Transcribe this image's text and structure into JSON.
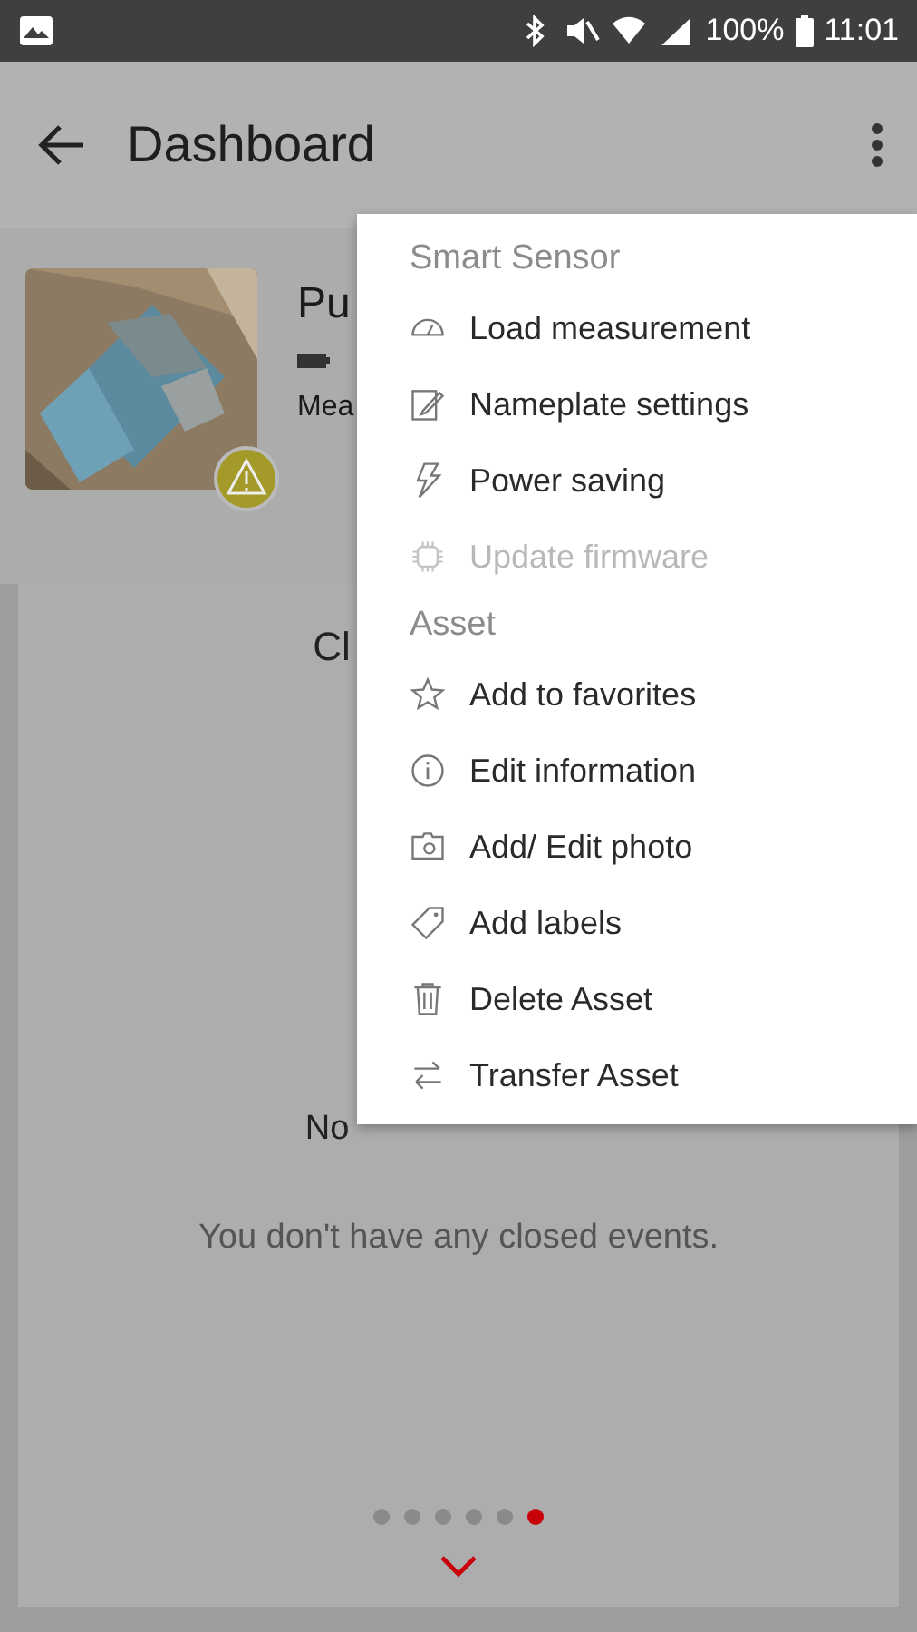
{
  "status_bar": {
    "battery": "100%",
    "time": "11:01"
  },
  "app_bar": {
    "title": "Dashboard"
  },
  "asset": {
    "warning": true,
    "name": "Pu",
    "meta": "Mea"
  },
  "card": {
    "title": "Cl",
    "heading": "No",
    "message": "You don't have any closed events."
  },
  "pager": {
    "dots": [
      {
        "selected": false
      },
      {
        "selected": false
      },
      {
        "selected": false
      },
      {
        "selected": false
      },
      {
        "selected": false
      },
      {
        "selected": true
      }
    ]
  },
  "menu": {
    "sections": [
      {
        "header": "Smart Sensor",
        "items": [
          {
            "label": "Load measurement",
            "disabled": false
          },
          {
            "label": "Nameplate settings",
            "disabled": false
          },
          {
            "label": "Power saving",
            "disabled": false
          },
          {
            "label": "Update firmware",
            "disabled": true
          }
        ]
      },
      {
        "header": "Asset",
        "items": [
          {
            "label": "Add to favorites",
            "disabled": false
          },
          {
            "label": "Edit information",
            "disabled": false
          },
          {
            "label": "Add/ Edit photo",
            "disabled": false
          },
          {
            "label": "Add labels",
            "disabled": false
          },
          {
            "label": "Delete Asset",
            "disabled": false
          },
          {
            "label": "Transfer Asset",
            "disabled": false
          }
        ]
      }
    ]
  }
}
